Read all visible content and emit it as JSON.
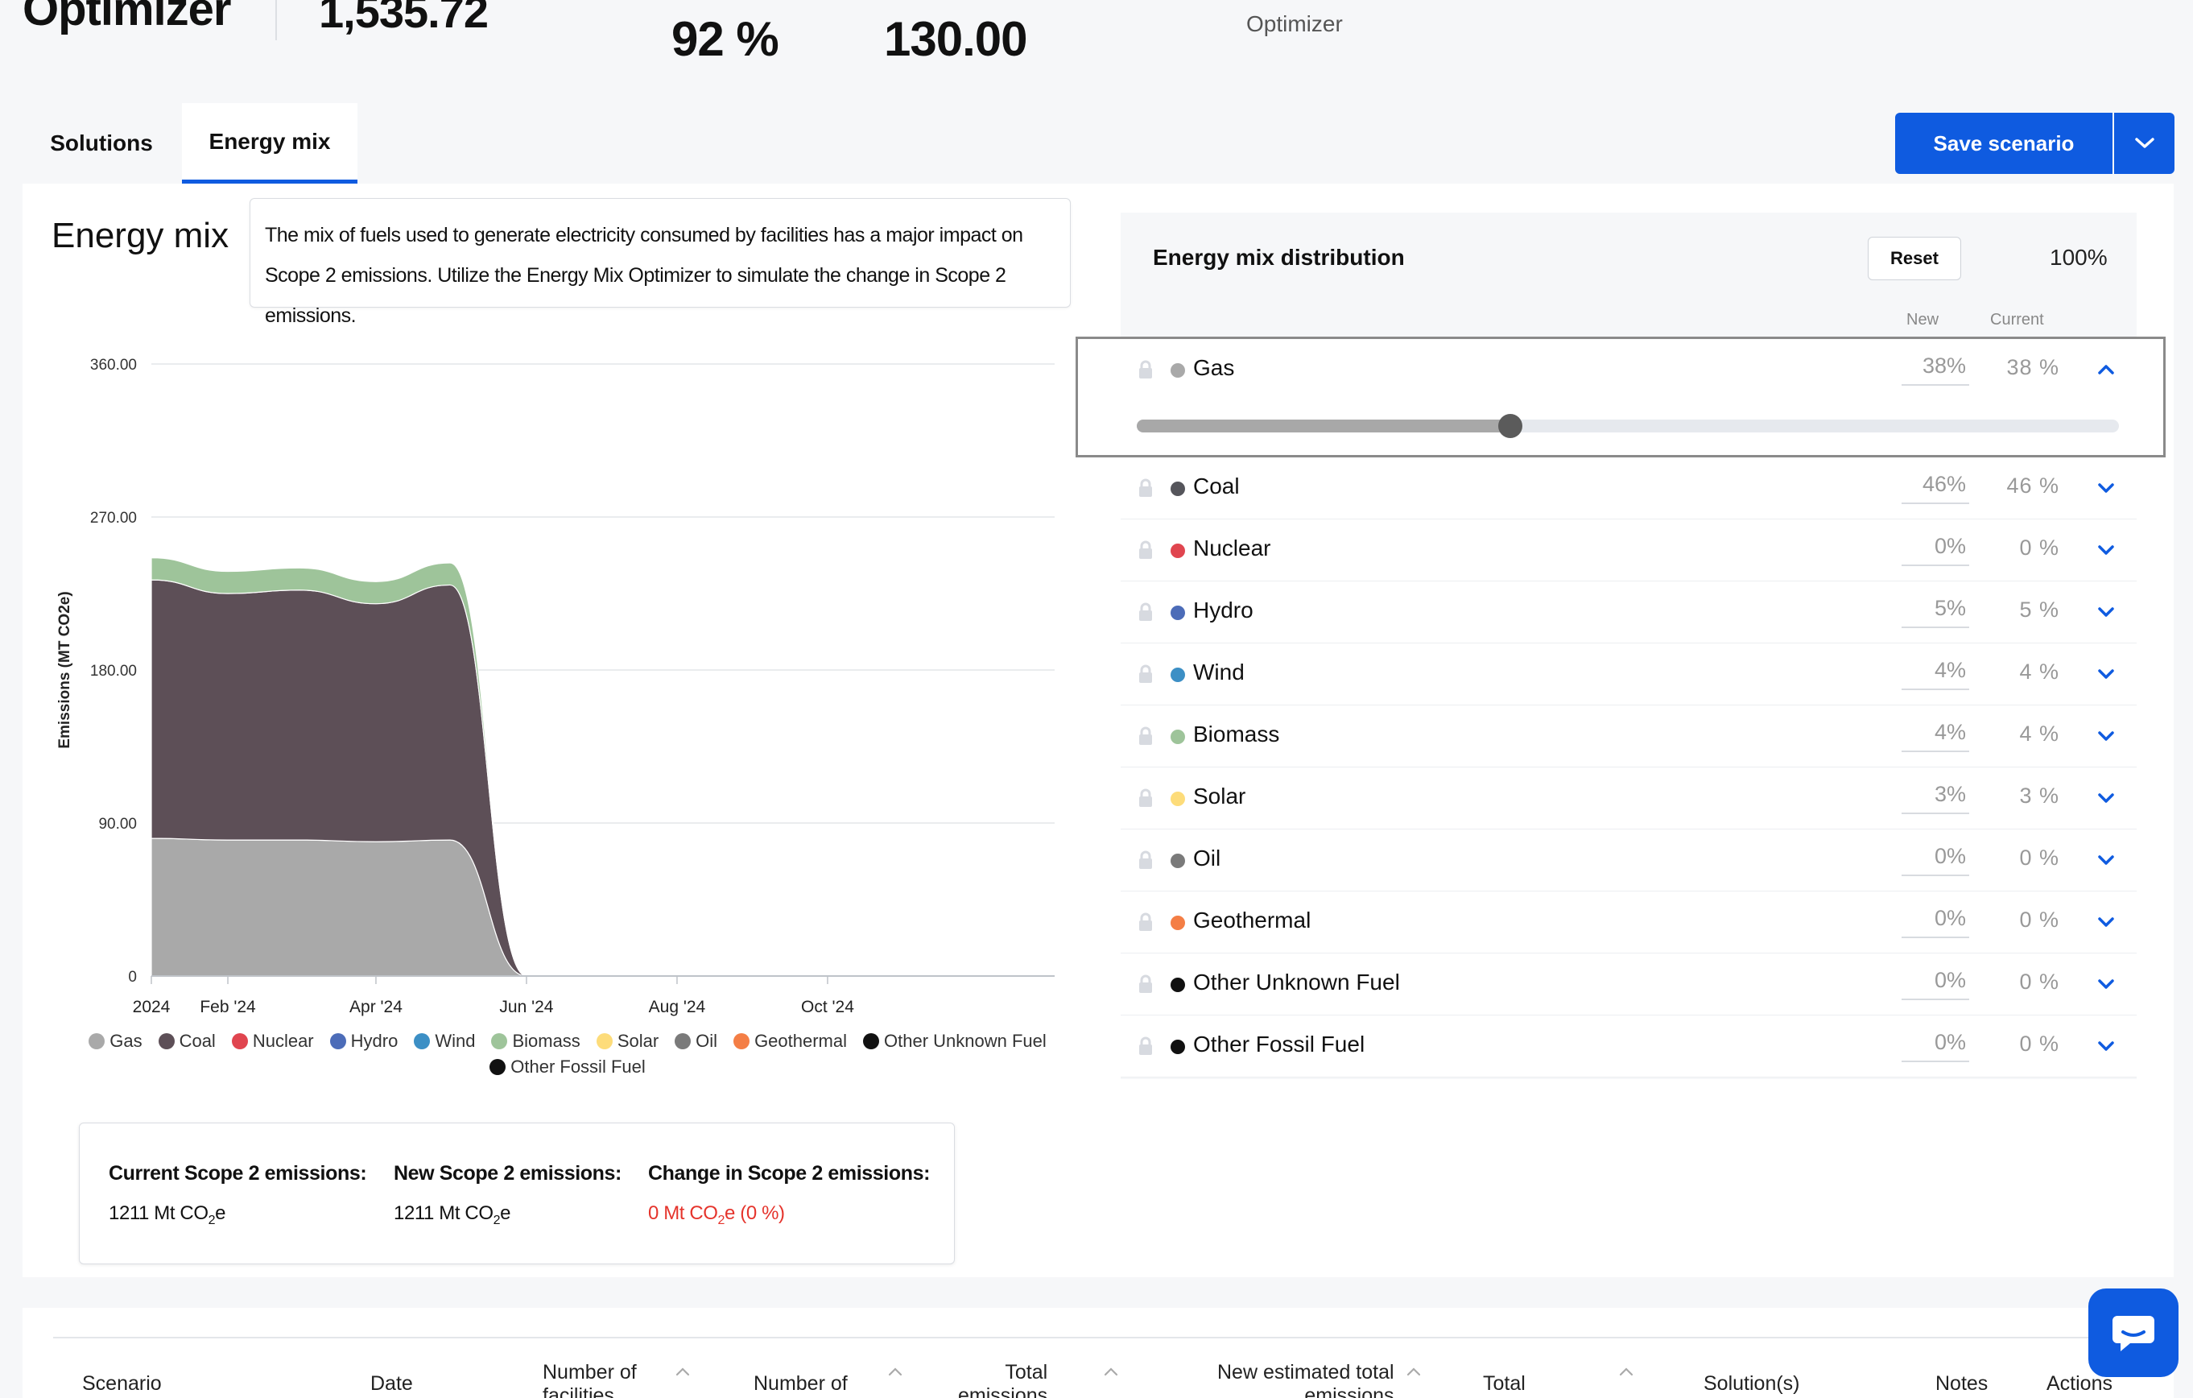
{
  "header": {
    "title": "Optimizer",
    "value1": "1,535.72",
    "value2": "92 %",
    "value3": "130.00",
    "optimizer_note": "Optimizer"
  },
  "tabs": [
    {
      "label": "Solutions",
      "active": false
    },
    {
      "label": "Energy mix",
      "active": true
    }
  ],
  "save": {
    "label": "Save scenario"
  },
  "section": {
    "title": "Energy mix",
    "description": "The mix of fuels used to generate electricity consumed by facilities has a major impact on Scope 2 emissions. Utilize the Energy Mix Optimizer to simulate the change in Scope 2 emissions."
  },
  "chart_data": {
    "type": "area",
    "title": "",
    "xlabel": "",
    "ylabel": "Emissions (MT CO2e)",
    "ylim": [
      0,
      360
    ],
    "y_ticks": [
      "0",
      "90.00",
      "180.00",
      "270.00",
      "360.00"
    ],
    "x_ticks": [
      "2024",
      "Feb '24",
      "Apr '24",
      "Jun '24",
      "Aug '24",
      "Oct '24"
    ],
    "x": [
      "2024-01-01",
      "2024-02-01",
      "2024-03-01",
      "2024-04-01",
      "2024-05-01",
      "2024-06-01",
      "2024-07-01",
      "2024-08-01",
      "2024-09-01",
      "2024-10-01",
      "2024-11-01",
      "2024-12-01"
    ],
    "stacked": true,
    "series": [
      {
        "name": "Gas",
        "color": "#a9a9a9",
        "values": [
          81,
          80,
          80,
          79,
          80,
          0,
          0,
          0,
          0,
          0,
          0,
          0
        ]
      },
      {
        "name": "Coal",
        "color": "#5d4f57",
        "values": [
          152,
          145,
          147,
          140,
          150,
          0,
          0,
          0,
          0,
          0,
          0,
          0
        ]
      },
      {
        "name": "Nuclear",
        "color": "#e0454f",
        "values": [
          0,
          0,
          0,
          0,
          0,
          0,
          0,
          0,
          0,
          0,
          0,
          0
        ]
      },
      {
        "name": "Hydro",
        "color": "#4c6cb8",
        "values": [
          0,
          0,
          0,
          0,
          0,
          0,
          0,
          0,
          0,
          0,
          0,
          0
        ]
      },
      {
        "name": "Wind",
        "color": "#3c8fc5",
        "values": [
          0,
          0,
          0,
          0,
          0,
          0,
          0,
          0,
          0,
          0,
          0,
          0
        ]
      },
      {
        "name": "Biomass",
        "color": "#9ec49a",
        "values": [
          13,
          13,
          13,
          13,
          13,
          0,
          0,
          0,
          0,
          0,
          0,
          0
        ]
      },
      {
        "name": "Solar",
        "color": "#fddc7a",
        "values": [
          0,
          0,
          0,
          0,
          0,
          0,
          0,
          0,
          0,
          0,
          0,
          0
        ]
      },
      {
        "name": "Oil",
        "color": "#7a7a7a",
        "values": [
          0,
          0,
          0,
          0,
          0,
          0,
          0,
          0,
          0,
          0,
          0,
          0
        ]
      },
      {
        "name": "Geothermal",
        "color": "#f47e45",
        "values": [
          0,
          0,
          0,
          0,
          0,
          0,
          0,
          0,
          0,
          0,
          0,
          0
        ]
      },
      {
        "name": "Other Unknown Fuel",
        "color": "#111111",
        "values": [
          0,
          0,
          0,
          0,
          0,
          0,
          0,
          0,
          0,
          0,
          0,
          0
        ]
      },
      {
        "name": "Other Fossil Fuel",
        "color": "#111111",
        "values": [
          0,
          0,
          0,
          0,
          0,
          0,
          0,
          0,
          0,
          0,
          0,
          0
        ]
      }
    ],
    "grid": true,
    "legend": "bottom"
  },
  "summary": {
    "current_label": "Current Scope 2 emissions:",
    "current_value": "1211 Mt CO",
    "new_label": "New Scope 2 emissions:",
    "new_value": "1211 Mt CO",
    "change_label": "Change in Scope 2 emissions:",
    "change_value_pre": "0 Mt CO",
    "change_value_post": "e (0 %)",
    "unit_suffix": "e",
    "subscript": "2"
  },
  "distribution": {
    "title": "Energy mix distribution",
    "reset_label": "Reset",
    "total": "100%",
    "col_new": "New",
    "col_current": "Current",
    "rows": [
      {
        "name": "Gas",
        "color": "#a9a9a9",
        "new": "38%",
        "current": "38 %",
        "expanded": true,
        "slider": 0.38
      },
      {
        "name": "Coal",
        "color": "#55555b",
        "new": "46%",
        "current": "46 %",
        "expanded": false
      },
      {
        "name": "Nuclear",
        "color": "#e0454f",
        "new": "0%",
        "current": "0 %",
        "expanded": false
      },
      {
        "name": "Hydro",
        "color": "#4c6cb8",
        "new": "5%",
        "current": "5 %",
        "expanded": false
      },
      {
        "name": "Wind",
        "color": "#3c8fc5",
        "new": "4%",
        "current": "4 %",
        "expanded": false
      },
      {
        "name": "Biomass",
        "color": "#9ec49a",
        "new": "4%",
        "current": "4 %",
        "expanded": false
      },
      {
        "name": "Solar",
        "color": "#fddc7a",
        "new": "3%",
        "current": "3 %",
        "expanded": false
      },
      {
        "name": "Oil",
        "color": "#7a7a7a",
        "new": "0%",
        "current": "0 %",
        "expanded": false
      },
      {
        "name": "Geothermal",
        "color": "#f47e45",
        "new": "0%",
        "current": "0 %",
        "expanded": false
      },
      {
        "name": "Other Unknown Fuel",
        "color": "#111111",
        "new": "0%",
        "current": "0 %",
        "expanded": false
      },
      {
        "name": "Other Fossil Fuel",
        "color": "#111111",
        "new": "0%",
        "current": "0 %",
        "expanded": false
      }
    ]
  },
  "table": {
    "headers": [
      {
        "label": "Scenario",
        "sortable": false
      },
      {
        "label": "Date",
        "sortable": false
      },
      {
        "label": "Number of\nfacilities",
        "sortable": true
      },
      {
        "label": "Number of",
        "sortable": true
      },
      {
        "label": "Total\nemissions",
        "sortable": true
      },
      {
        "label": "New estimated total\nemissions",
        "sortable": true
      },
      {
        "label": "Total",
        "sortable": true
      },
      {
        "label": "Solution(s)",
        "sortable": false
      },
      {
        "label": "Notes",
        "sortable": false
      },
      {
        "label": "Actions",
        "sortable": false
      }
    ]
  },
  "colors": {
    "accent": "#0f5be0",
    "negative": "#e5342c"
  }
}
